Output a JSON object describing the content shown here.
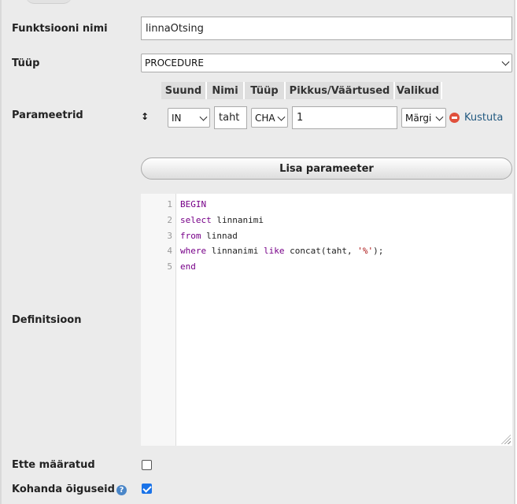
{
  "form": {
    "name_label": "Funktsiooni nimi",
    "name_value": "linnaOtsing",
    "type_label": "Tüüp",
    "type_value": "PROCEDURE",
    "params_label": "Parameetrid",
    "definition_label": "Definitsioon",
    "deterministic_label": "Ette määratud",
    "deterministic_checked": false,
    "privileges_label": "Kohanda õiguseid",
    "privileges_checked": true
  },
  "params": {
    "headers": [
      "Suund",
      "Nimi",
      "Tüüp",
      "Pikkus/Väärtused",
      "Valikud"
    ],
    "row": {
      "drag_handle": "↕",
      "direction": "IN",
      "name": "taht",
      "type": "CHA",
      "length": "1",
      "options": "Märgi",
      "remove_label": "Kustuta"
    },
    "add_button": "Lisa parameeter"
  },
  "code": {
    "line_numbers": [
      "1",
      "2",
      "3",
      "4",
      "5"
    ],
    "lines": [
      [
        {
          "t": "BEGIN",
          "c": "kw"
        }
      ],
      [
        {
          "t": "select",
          "c": "kw"
        },
        {
          "t": " linnanimi",
          "c": ""
        }
      ],
      [
        {
          "t": "from",
          "c": "kw"
        },
        {
          "t": " linnad",
          "c": ""
        }
      ],
      [
        {
          "t": "where",
          "c": "kw"
        },
        {
          "t": " linnanimi ",
          "c": ""
        },
        {
          "t": "like",
          "c": "kw"
        },
        {
          "t": " concat(taht, ",
          "c": ""
        },
        {
          "t": "'%'",
          "c": "str"
        },
        {
          "t": ");",
          "c": ""
        }
      ],
      [
        {
          "t": "end",
          "c": "kw"
        }
      ]
    ]
  },
  "icons": {
    "help": "help-icon",
    "remove": "remove-circle-icon",
    "drag": "drag-handle-icon",
    "dropdown": "chevron-down-icon"
  },
  "colors": {
    "keyword": "#770088",
    "string": "#aa1111",
    "link": "#235a81",
    "checkbox_checked": "#1a73e8",
    "remove": "#e0503c"
  }
}
